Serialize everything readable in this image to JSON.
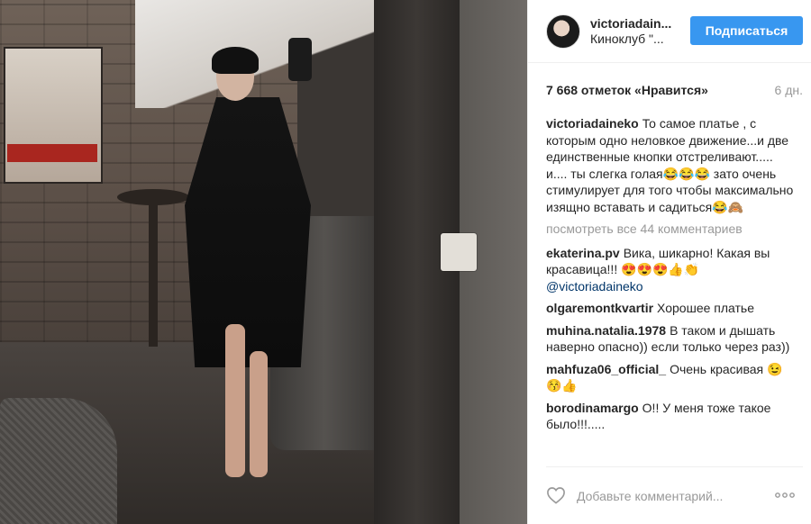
{
  "header": {
    "username": "victoriadain...",
    "location": "Киноклуб \"...",
    "follow_label": "Подписаться"
  },
  "meta": {
    "likes": "7 668 отметок «Нравится»",
    "time": "6 дн."
  },
  "caption": {
    "user": "victoriadaineko",
    "text": "То самое платье , с которым одно неловкое движение...и две единственные кнопки отстреливают..... и.... ты слегка голая😂😂😂 зато очень стимулирует для того чтобы максимально изящно вставать и садиться😂🙈"
  },
  "view_all": "посмотреть все 44 комментариев",
  "comments": [
    {
      "user": "ekaterina.pv",
      "text": "Вика, шикарно! Какая вы красавица!!! 😍😍😍👍👏",
      "mention": "@victoriadaineko"
    },
    {
      "user": "olgaremontkvartir",
      "text": "Хорошее платье"
    },
    {
      "user": "muhina.natalia.1978",
      "text": "В таком и дышать наверно опасно)) если только через раз))"
    },
    {
      "user": "mahfuza06_official_",
      "text": "Очень красивая 😉😚👍"
    },
    {
      "user": "borodinamargo",
      "text": "О!! У меня тоже такое было!!!....."
    }
  ],
  "add_comment": {
    "placeholder": "Добавьте комментарий..."
  },
  "colors": {
    "accent": "#3897f0",
    "meta_gray": "#999999",
    "mention": "#003569"
  },
  "icons": {
    "like": "heart-icon",
    "options": "more-options-icon"
  }
}
